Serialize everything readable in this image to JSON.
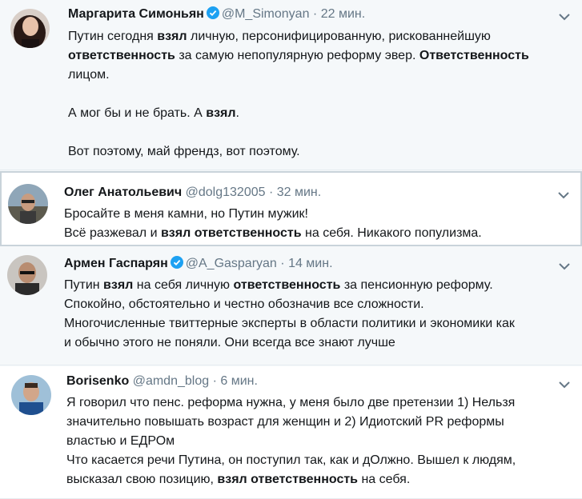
{
  "tweets": [
    {
      "name": "Маргарита Симоньян",
      "handle": "@M_Simonyan",
      "dot": "·",
      "time": "22 мин.",
      "verified": true,
      "lines": [
        [
          "Путин сегодня ",
          {
            "b": "взял"
          },
          " личную, персонифицированную, рискованнейшую"
        ],
        [
          {
            "b": "ответственность"
          },
          " за самую непопулярную реформу эвер. ",
          {
            "b": "Ответственность"
          }
        ],
        [
          "лицом."
        ],
        [],
        [
          "А мог бы и не брать. А ",
          {
            "b": "взял"
          },
          "."
        ],
        [],
        [
          "Вот поэтому, май френдз, вот поэтому."
        ]
      ]
    },
    {
      "name": "Олег Анатольевич",
      "handle": "@dolg132005",
      "dot": "·",
      "time": "32 мин.",
      "verified": false,
      "lines": [
        [
          "Бросайте в меня камни, но Путин мужик!"
        ],
        [
          "Всё разжевал и ",
          {
            "b": "взял ответственность"
          },
          " на себя. Никакого популизма."
        ]
      ]
    },
    {
      "name": "Армен Гаспарян",
      "handle": "@A_Gasparyan",
      "dot": "·",
      "time": "14 мин.",
      "verified": true,
      "lines": [
        [
          "Путин ",
          {
            "b": "взял"
          },
          " на себя личную ",
          {
            "b": "ответственность"
          },
          " за пенсионную реформу."
        ],
        [
          "Спокойно, обстоятельно и честно обозначив все сложности."
        ],
        [
          "Многочисленные твиттерные эксперты в области политики и экономики как"
        ],
        [
          "и обычно этого не поняли. Они всегда все знают лучше"
        ]
      ]
    },
    {
      "name": "Borisenko",
      "handle": "@amdn_blog",
      "dot": "·",
      "time": "6 мин.",
      "verified": false,
      "lines": [
        [
          "Я говорил что пенс. реформа нужна, у меня было две претензии 1) Нельзя"
        ],
        [
          "значительно повышать возраст для женщин и 2) Идиотский PR реформы"
        ],
        [
          "властью и ЕДРОм"
        ],
        [
          "Что касается речи Путина, он поступил так, как и дОлжно. Вышел к людям,"
        ],
        [
          "высказал свою позицию, ",
          {
            "b": "взял ответственность"
          },
          " на себя."
        ]
      ]
    }
  ],
  "colors": {
    "verified": "#1da1f2",
    "muted": "#657786",
    "text": "#14171a"
  },
  "icons": {
    "verified": "verified-badge-icon",
    "more": "chevron-down-icon"
  }
}
